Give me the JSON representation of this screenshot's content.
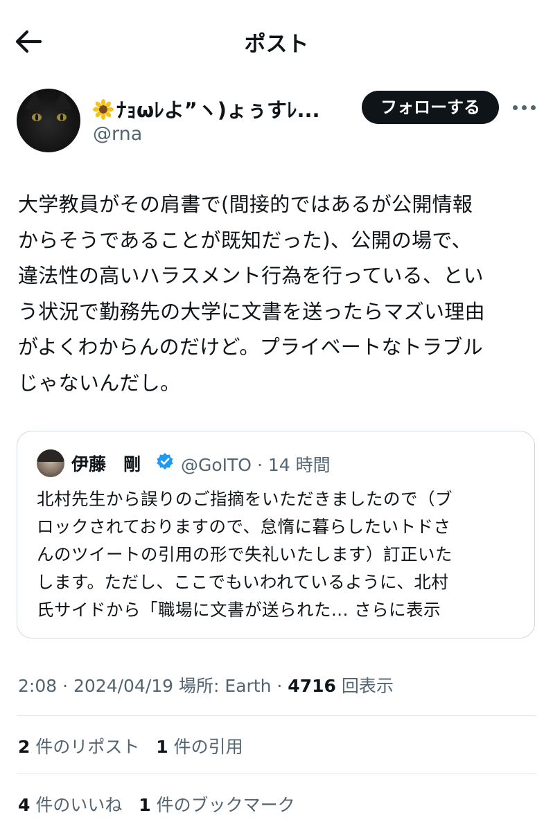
{
  "header": {
    "title": "ポスト",
    "back_icon": "arrow-left-icon"
  },
  "author": {
    "display_name": "ﾅｮωﾚよ”ヽ)ょぅすﾚ...",
    "username": "@rna",
    "follow_label": "フォローする",
    "more_icon": "more-horizontal-icon",
    "name_emoji": "sunflower-icon"
  },
  "post": {
    "text": "大学教員がその肩書で(間接的ではあるが公開情報\nからそうであることが既知だった)、公開の場で、\n違法性の高いハラスメント行為を行っている、とい\nう状況で勤務先の大学に文書を送ったらマズい理由\nがよくわからんのだけど。プライベートなトラブル\nじゃないんだし。"
  },
  "quote": {
    "name": "伊藤　剛",
    "handle": "@GoITO",
    "separator": "·",
    "time": "14 時間",
    "text": "北村先生から誤りのご指摘をいただきましたので（ブ\nロックされておりますので、怠惰に暮らしたいトドさ\nんのツイートの引用の形で失礼いたします）訂正いた\nします。ただし、ここでもいわれているように、北村\n氏サイドから「職場に文書が送られた... ",
    "more_label": "さらに表示"
  },
  "meta": {
    "time": "2:08",
    "date": "2024/04/19",
    "location": "場所: Earth",
    "views_count": "4716",
    "views_label": "回表示",
    "sep": " · "
  },
  "stats": {
    "reposts_count": "2",
    "reposts_label": "件のリポスト",
    "quotes_count": "1",
    "quotes_label": "件の引用",
    "likes_count": "4",
    "likes_label": "件のいいね",
    "bookmarks_count": "1",
    "bookmarks_label": "件のブックマーク"
  },
  "colors": {
    "text": "#0f1419",
    "secondary": "#536471",
    "verified": "#1d9bf0",
    "border": "#cfd9de"
  }
}
